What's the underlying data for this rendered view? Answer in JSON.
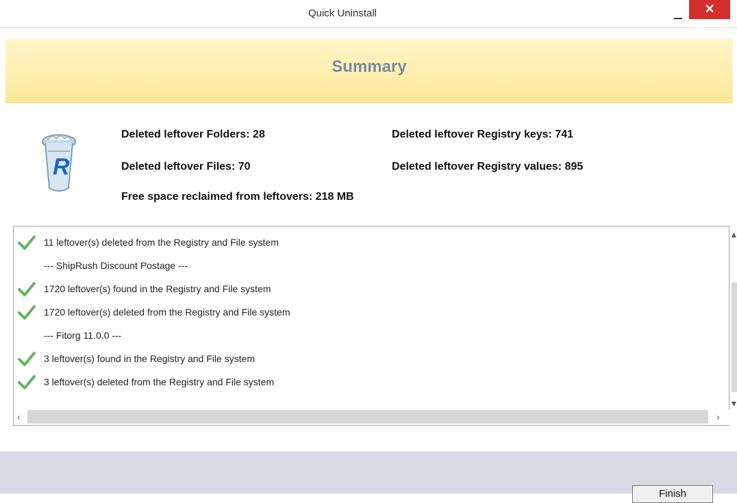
{
  "window": {
    "title": "Quick Uninstall",
    "minimize_symbol": "−",
    "close_symbol": "✕"
  },
  "summary": {
    "title": "Summary",
    "stats": {
      "folders": "Deleted leftover Folders: 28",
      "files": "Deleted leftover Files: 70",
      "free_space": "Free space reclaimed from leftovers: 218 MB",
      "registry_keys": "Deleted leftover Registry keys: 741",
      "registry_values": "Deleted leftover Registry values: 895"
    }
  },
  "log": [
    {
      "text": "11 leftover(s) deleted from the Registry and File system",
      "icon": "check-icon"
    },
    {
      "text": "--- ShipRush Discount Postage ---",
      "icon": ""
    },
    {
      "text": "1720 leftover(s) found in the Registry and File system",
      "icon": "check-icon"
    },
    {
      "text": "1720 leftover(s) deleted from the Registry and File system",
      "icon": "check-icon"
    },
    {
      "text": "--- Fitorg 11.0.0 ---",
      "icon": ""
    },
    {
      "text": "3 leftover(s) found in the Registry and File system",
      "icon": "check-icon"
    },
    {
      "text": "3 leftover(s) deleted from the Registry and File system",
      "icon": "check-icon"
    }
  ],
  "footer": {
    "finish_label": "Finish"
  },
  "colors": {
    "accent": "#7a8aa6",
    "close_red": "#d32f2f",
    "check_green": "#5cb85c"
  }
}
